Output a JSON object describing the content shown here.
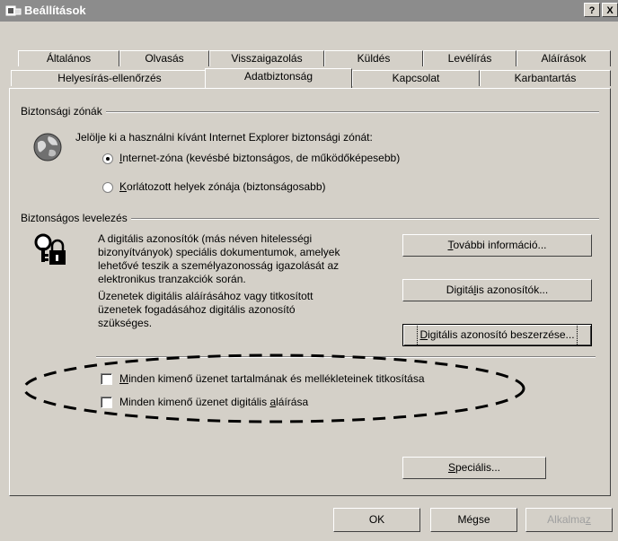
{
  "window": {
    "title": "Beállítások",
    "help_label": "?",
    "close_label": "X"
  },
  "tabs": {
    "row1": [
      {
        "label": "Általános"
      },
      {
        "label": "Olvasás"
      },
      {
        "label": "Visszaigazolás"
      },
      {
        "label": "Küldés"
      },
      {
        "label": "Levélírás"
      },
      {
        "label": "Aláírások"
      }
    ],
    "row2": [
      {
        "label": "Helyesírás-ellenőrzés"
      },
      {
        "label": "Adatbiztonság"
      },
      {
        "label": "Kapcsolat"
      },
      {
        "label": "Karbantartás"
      }
    ],
    "active": "Adatbiztonság"
  },
  "security_zones": {
    "group_label": "Biztonsági zónák",
    "prompt": "Jelölje ki a használni kívánt Internet Explorer biztonsági zónát:",
    "options": [
      {
        "label_prefix": "",
        "label_underline": "I",
        "label_rest": "nternet-zóna (kevésbé biztonságos, de működőképesebb)",
        "selected": true
      },
      {
        "label_prefix": "",
        "label_underline": "K",
        "label_rest": "orlátozott helyek zónája (biztonságosabb)",
        "selected": false
      }
    ]
  },
  "secure_mail": {
    "group_label": "Biztonságos levelezés",
    "description_lines": [
      "A digitális azonosítók (más néven hitelességi",
      "bizonyítványok) speciális dokumentumok, amelyek",
      "lehetővé teszik a személyazonosság igazolását az",
      "elektronikus tranzakciók során."
    ],
    "info_lines": [
      "Üzenetek digitális aláírásához vagy titkosított",
      "üzenetek fogadásához digitális azonosító",
      "szükséges."
    ],
    "buttons": {
      "more_info": {
        "underline": "T",
        "rest": "ovábbi információ..."
      },
      "digital_ids": {
        "prefix": "Digitá",
        "underline": "l",
        "rest": "is azonosítók..."
      },
      "get_id": {
        "underline": "D",
        "rest": "igitális azonosító beszerzése..."
      }
    },
    "checkboxes": [
      {
        "underline": "M",
        "rest": "inden kimenő üzenet tartalmának és mellékleteinek titkosítása",
        "checked": false
      },
      {
        "prefix": "Minden kimenő üzenet digitális ",
        "underline": "a",
        "rest": "láírása",
        "checked": false
      }
    ]
  },
  "advanced_button": {
    "underline": "S",
    "rest": "peciális..."
  },
  "footer": {
    "ok": "OK",
    "cancel": "Mégse",
    "apply_prefix": "Alkalma",
    "apply_underline": "z"
  }
}
